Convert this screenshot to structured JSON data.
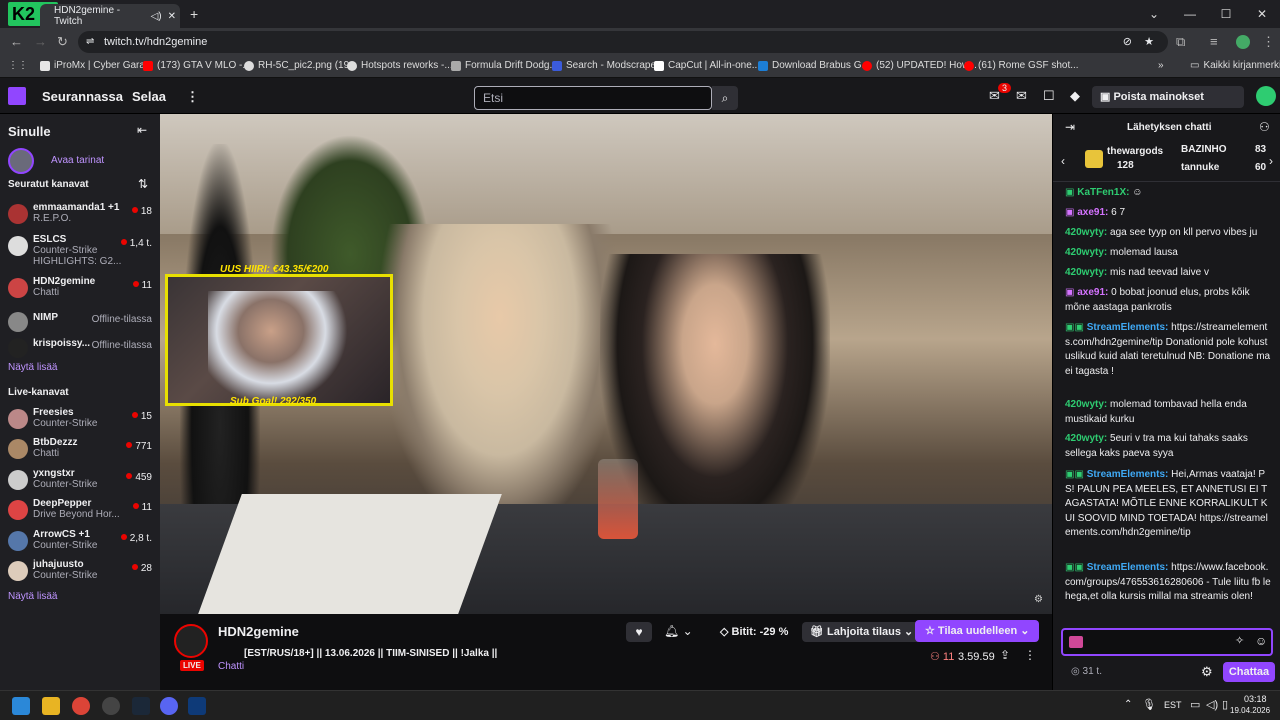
{
  "browser": {
    "tab_title": "HDN2gemine - Twitch",
    "url": "twitch.tv/hdn2gemine",
    "bookmarks": [
      {
        "label": "iProMx | Cyber Gara...",
        "color": "#e6e6e6"
      },
      {
        "label": "(173) GTA V MLO -...",
        "color": "#ff0000"
      },
      {
        "label": "RH-5C_pic2.png (19...",
        "color": "#dddddd"
      },
      {
        "label": "Hotspots reworks -...",
        "color": "#dddddd"
      },
      {
        "label": "Formula Drift Dodg...",
        "color": "#aaaaaa"
      },
      {
        "label": "Search - Modscrape...",
        "color": "#3b5bdb"
      },
      {
        "label": "CapCut | All-in-one...",
        "color": "#ffffff"
      },
      {
        "label": "Download Brabus G...",
        "color": "#1c7ed6"
      },
      {
        "label": "(52) UPDATED! How...",
        "color": "#ff0000"
      },
      {
        "label": "(61) Rome GSF shot...",
        "color": "#ff0000"
      }
    ],
    "bookmarks_folder": "Kaikki kirjanmerkit"
  },
  "twitch_nav": {
    "following": "Seurannassa",
    "browse": "Selaa",
    "search_placeholder": "Etsi",
    "notifications_count": "3",
    "remove_ads": "Poista mainokset ilmaiseksi"
  },
  "sidebar": {
    "title": "Sinulle",
    "stories": "Avaa tarinat",
    "followed_heading": "Seuratut kanavat",
    "followed": [
      {
        "name": "emmaamanda1 +1",
        "game": "R.E.P.O.",
        "viewers": "18",
        "color": "#a33"
      },
      {
        "name": "ESLCS",
        "game": "Counter-Strike",
        "extra": "HIGHLIGHTS: G2...",
        "viewers": "1,4 t.",
        "color": "#ddd"
      },
      {
        "name": "HDN2gemine",
        "game": "Chatti",
        "viewers": "11",
        "color": "#c44"
      },
      {
        "name": "NIMP",
        "game": "",
        "offline": "Offline-tilassa",
        "color": "#888"
      },
      {
        "name": "krispoissy...",
        "game": "",
        "offline": "Offline-tilassa",
        "color": "#222"
      }
    ],
    "show_more": "Näytä lisää",
    "live_heading": "Live-kanavat",
    "live": [
      {
        "name": "Freesies",
        "game": "Counter-Strike",
        "viewers": "15",
        "color": "#b88"
      },
      {
        "name": "BtbDezzz",
        "game": "Chatti",
        "viewers": "771",
        "color": "#a86"
      },
      {
        "name": "yxngstxr",
        "game": "Counter-Strike",
        "viewers": "459",
        "color": "#ccc"
      },
      {
        "name": "DeepPepper",
        "game": "Drive Beyond Hor...",
        "viewers": "11",
        "color": "#d44"
      },
      {
        "name": "ArrowCS +1",
        "game": "Counter-Strike",
        "viewers": "2,8 t.",
        "color": "#57a"
      },
      {
        "name": "juhajuusto",
        "game": "Counter-Strike",
        "viewers": "28",
        "color": "#dcb"
      }
    ],
    "show_more_2": "Näytä lisää"
  },
  "video": {
    "overlay_top": "UUS HIIRI: €43.35/€200",
    "overlay_bottom": "Sub Goal! 292/350"
  },
  "stream": {
    "channel": "HDN2gemine",
    "live_badge": "LIVE",
    "title": "[EST/RUS/18+] || 13.06.2026 || TIIM-SINISED || !Jalka ||",
    "category": "Chatti",
    "bits": "Bitit: -29 %",
    "gift": "Lahjoita tilaus",
    "resub": "Tilaa uudelleen",
    "viewers": "11",
    "uptime": "3.59.59"
  },
  "chat": {
    "title": "Lähetyksen chatti",
    "leaders": [
      {
        "name": "thewargods",
        "score": "128"
      },
      {
        "name": "BAZINHO",
        "score": "83"
      },
      {
        "name": "tannuke",
        "score": "60"
      }
    ],
    "messages": [
      {
        "user": "KaTFen1X:",
        "color": "#2ecc71",
        "text": ""
      },
      {
        "user": "axe91:",
        "color": "#d473ff",
        "text": "6 7"
      },
      {
        "user": "420wyty:",
        "color": "#2ecc71",
        "text": "aga see tyyp on kll pervo vibes ju"
      },
      {
        "user": "420wyty:",
        "color": "#2ecc71",
        "text": "molemad lausa"
      },
      {
        "user": "420wyty:",
        "color": "#2ecc71",
        "text": "mis nad teevad laive v"
      },
      {
        "user": "axe91:",
        "color": "#d473ff",
        "text": "0 bobat joonud elus, probs kõik mõne aastaga pankrotis"
      },
      {
        "user": "StreamElements:",
        "color": "#3fa9f5",
        "text": "https://streamelements.com/hdn2gemine/tip Donationid pole kohustuslikud kuid alati teretulnud NB: Donatione ma ei tagasta !"
      },
      {
        "user": "420wyty:",
        "color": "#2ecc71",
        "text": "molemad tombavad hella enda mustikaid kurku"
      },
      {
        "user": "420wyty:",
        "color": "#2ecc71",
        "text": "5euri v tra ma kui tahaks saaks sellega kaks paeva syya"
      },
      {
        "user": "StreamElements:",
        "color": "#3fa9f5",
        "text": "Hei,Armas vaataja! PS! PALUN PEA MEELES, ET ANNETUSI EI TAGASTATA! MÕTLE ENNE KORRALIKULT KUI SOOVID MIND TOETADA! https://streamelements.com/hdn2gemine/tip"
      },
      {
        "user": "StreamElements:",
        "color": "#3fa9f5",
        "text": "https://www.facebook.com/groups/476553616280606 - Tule liitu fb lehega,et olla kursis millal ma streamis olen!"
      }
    ],
    "points": "31 t.",
    "send": "Chattaa"
  },
  "taskbar": {
    "lang": "EST",
    "time": "03:18",
    "date": "19.04.2026"
  }
}
